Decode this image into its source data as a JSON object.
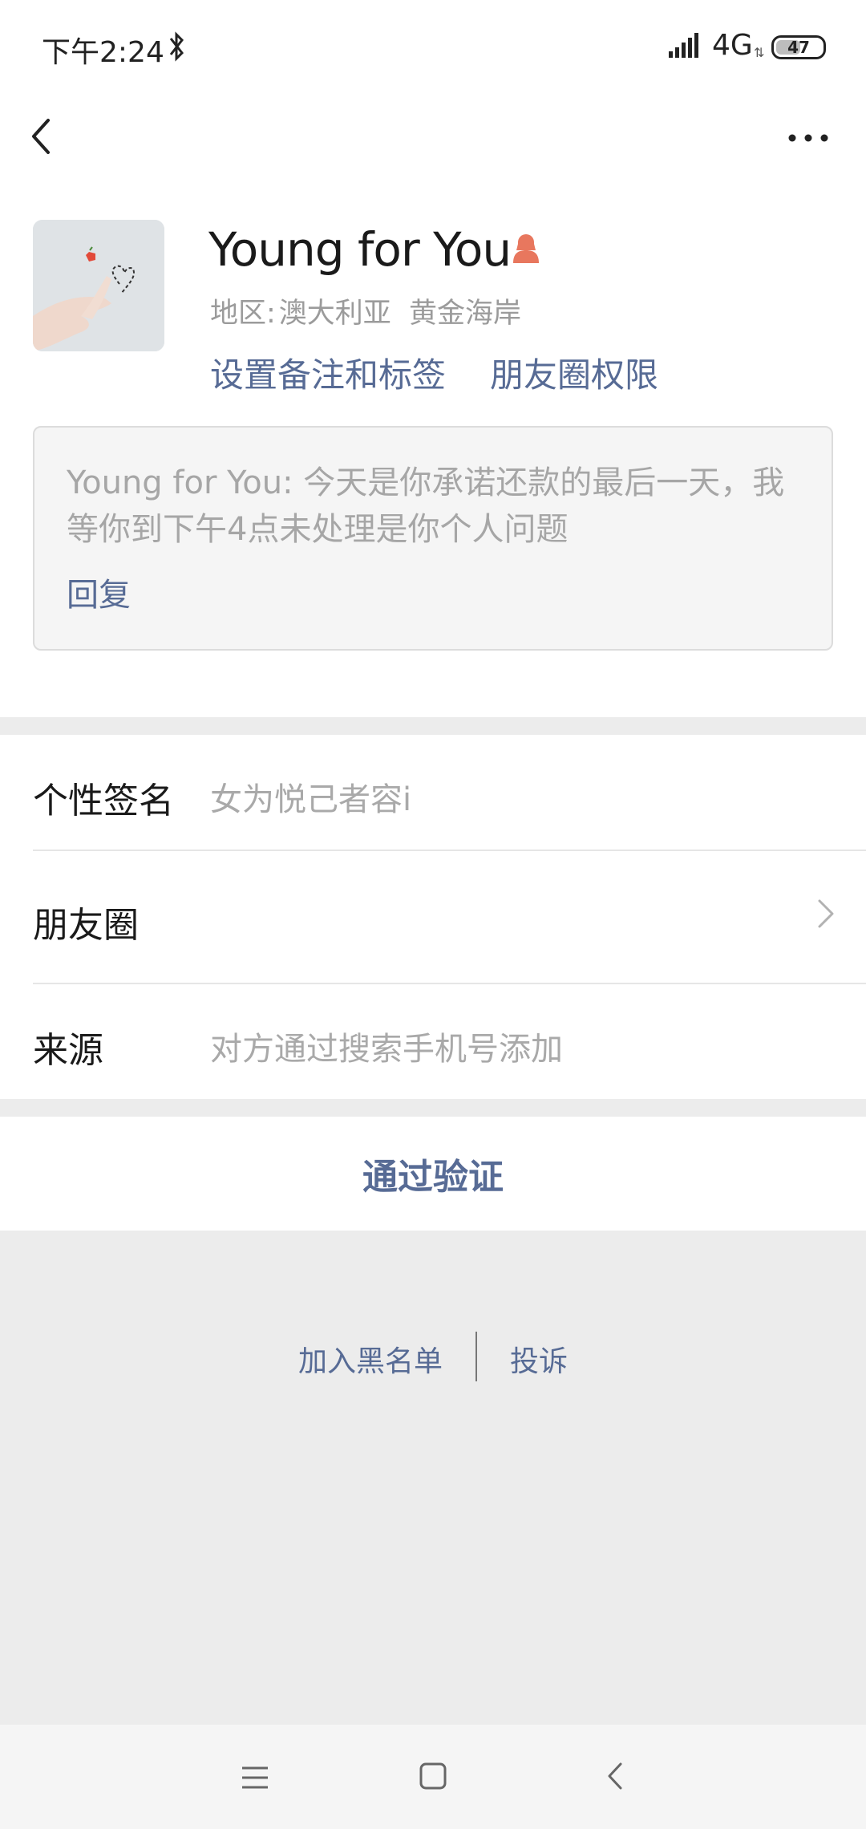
{
  "status_bar": {
    "time": "下午2:24",
    "network": "4G",
    "network_arrows": "⇅",
    "battery": "47"
  },
  "icons": {
    "back": "chevron-left-icon",
    "more": "more-dots-icon",
    "gender": "female-icon",
    "bluetooth": "bluetooth-icon",
    "signal": "signal-icon"
  },
  "profile": {
    "name": "Young for You",
    "region_label": "地区:",
    "region_value": "澳大利亚  黄金海岸",
    "set_remark_label": "设置备注和标签",
    "moments_permission_label": "朋友圈权限"
  },
  "message": {
    "text": "Young for You: 今天是你承诺还款的最后一天，我等你到下午4点未处理是你个人问题",
    "reply_label": "回复"
  },
  "details": {
    "signature_label": "个性签名",
    "signature_value": "女为悦己者容i",
    "moments_label": "朋友圈",
    "source_label": "来源",
    "source_value": "对方通过搜索手机号添加"
  },
  "actions": {
    "verify_label": "通过验证",
    "blacklist_label": "加入黑名单",
    "complain_label": "投诉"
  },
  "colors": {
    "link": "#576b95",
    "background": "#ececec",
    "gender_icon": "#e8775e"
  }
}
